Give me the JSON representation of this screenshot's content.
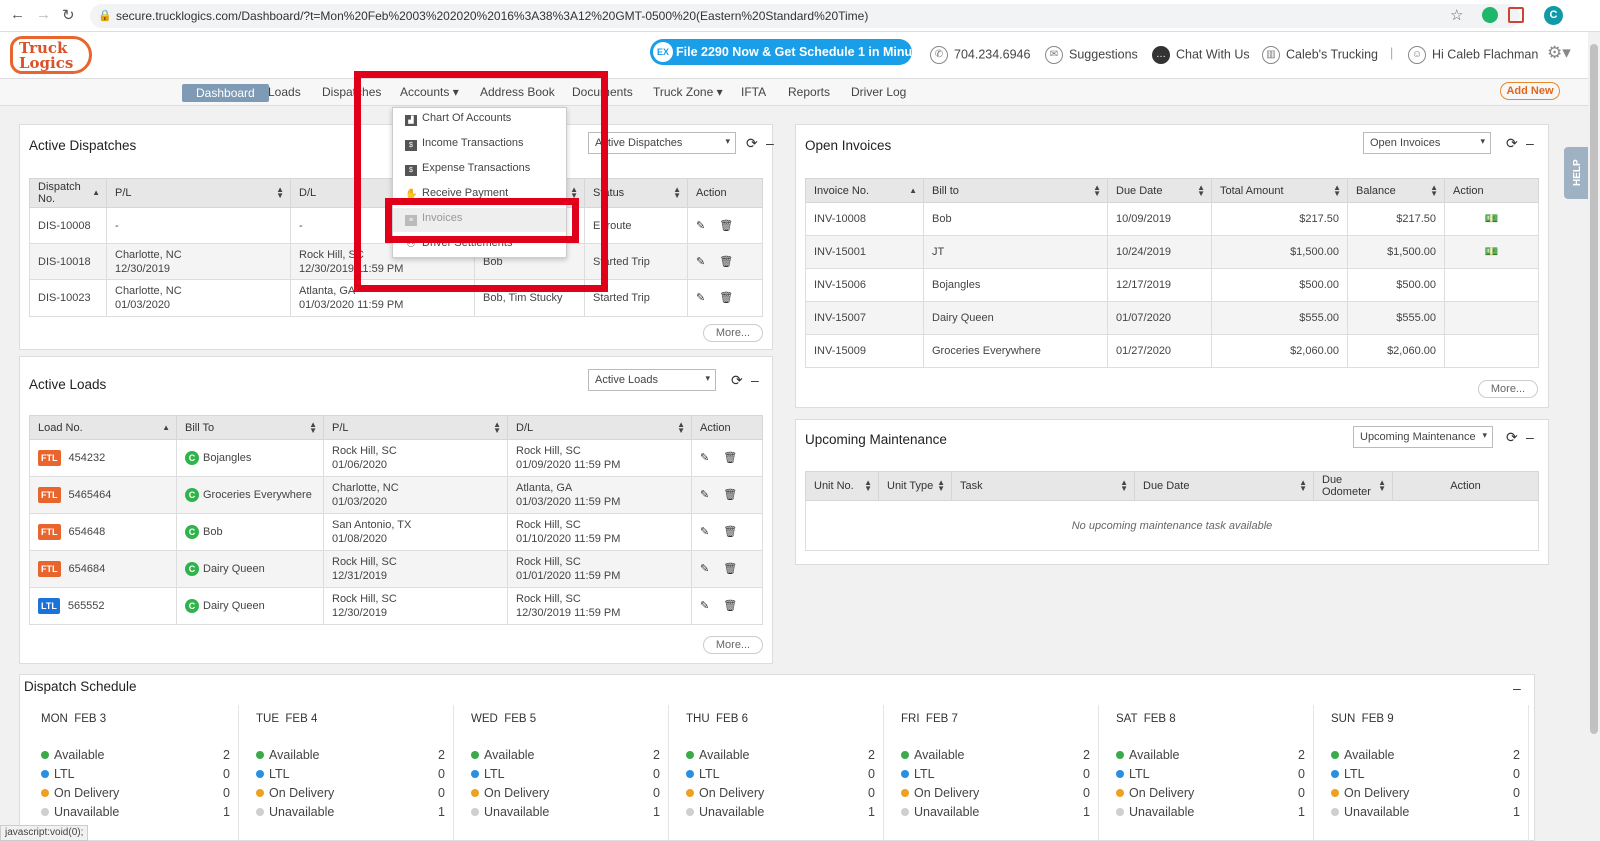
{
  "browser": {
    "url": "secure.trucklogics.com/Dashboard/?t=Mon%20Feb%2003%202020%2016%3A38%3A12%20GMT-0500%20(Eastern%20Standard%20Time)",
    "account_initial": "C",
    "status_text": "javascript:void(0);"
  },
  "header": {
    "logo_line1": "Truck",
    "logo_line2": "Logics",
    "promo": "File 2290 Now & Get Schedule 1 in Minutes",
    "promo_icon": "EX",
    "phone": "704.234.6946",
    "suggestions": "Suggestions",
    "chat": "Chat With Us",
    "company": "Caleb's Trucking",
    "greeting": "Hi Caleb Flachman",
    "icons": [
      "phone-icon",
      "suggestions-icon",
      "chat-icon",
      "company-icon",
      "user-icon",
      "gear-icon"
    ]
  },
  "menu": {
    "items": [
      "Dashboard",
      "Loads",
      "Dispatches",
      "Accounts",
      "Address Book",
      "Documents",
      "Truck Zone",
      "IFTA",
      "Reports",
      "Driver Log"
    ],
    "add_new": "Add New"
  },
  "accounts_menu": [
    "Chart Of Accounts",
    "Income Transactions",
    "Expense Transactions",
    "Receive Payment",
    "Invoices",
    "Driver Settlements"
  ],
  "dispatches": {
    "title": "Active Dispatches",
    "select": "Active Dispatches",
    "headers": [
      "Dispatch No.",
      "P/L",
      "D/L",
      "",
      "Status",
      "Action"
    ],
    "rows": [
      {
        "no": "DIS-10008",
        "pl1": "-",
        "pl2": "",
        "dl1": "-",
        "dl2": "",
        "driver": "",
        "status": "Enroute"
      },
      {
        "no": "DIS-10018",
        "pl1": "Charlotte, NC",
        "pl2": "12/30/2019",
        "dl1": "Rock Hill, SC",
        "dl2": "12/30/2019 11:59 PM",
        "driver": "Bob",
        "status": "Started Trip"
      },
      {
        "no": "DIS-10023",
        "pl1": "Charlotte, NC",
        "pl2": "01/03/2020",
        "dl1": "Atlanta, GA",
        "dl2": "01/03/2020 11:59 PM",
        "driver": "Bob, Tim Stucky",
        "status": "Started Trip"
      }
    ],
    "more": "More..."
  },
  "loads": {
    "title": "Active Loads",
    "select": "Active Loads",
    "headers": [
      "Load No.",
      "Bill To",
      "P/L",
      "D/L",
      "Action"
    ],
    "rows": [
      {
        "type": "FTL",
        "no": "454232",
        "bill": "Bojangles",
        "pl1": "Rock Hill, SC",
        "pl2": "01/06/2020",
        "dl1": "Rock Hill, SC",
        "dl2": "01/09/2020 11:59 PM"
      },
      {
        "type": "FTL",
        "no": "5465464",
        "bill": "Groceries Everywhere",
        "pl1": "Charlotte, NC",
        "pl2": "01/03/2020",
        "dl1": "Atlanta, GA",
        "dl2": "01/03/2020 11:59 PM"
      },
      {
        "type": "FTL",
        "no": "654648",
        "bill": "Bob",
        "pl1": "San Antonio, TX",
        "pl2": "01/08/2020",
        "dl1": "Rock Hill, SC",
        "dl2": "01/10/2020 11:59 PM"
      },
      {
        "type": "FTL",
        "no": "654684",
        "bill": "Dairy Queen",
        "pl1": "Rock Hill, SC",
        "pl2": "12/31/2019",
        "dl1": "Rock Hill, SC",
        "dl2": "01/01/2020 11:59 PM"
      },
      {
        "type": "LTL",
        "no": "565552",
        "bill": "Dairy Queen",
        "pl1": "Rock Hill, SC",
        "pl2": "12/30/2019",
        "dl1": "Rock Hill, SC",
        "dl2": "12/30/2019 11:59 PM"
      }
    ],
    "badge": "C",
    "more": "More..."
  },
  "invoices": {
    "title": "Open Invoices",
    "select": "Open Invoices",
    "headers": [
      "Invoice No.",
      "Bill to",
      "Due Date",
      "Total Amount",
      "Balance",
      "Action"
    ],
    "rows": [
      {
        "no": "INV-10008",
        "bill": "Bob",
        "due": "10/09/2019",
        "total": "$217.50",
        "balance": "$217.50"
      },
      {
        "no": "INV-15001",
        "bill": "JT",
        "due": "10/24/2019",
        "total": "$1,500.00",
        "balance": "$1,500.00"
      },
      {
        "no": "INV-15006",
        "bill": "Bojangles",
        "due": "12/17/2019",
        "total": "$500.00",
        "balance": "$500.00"
      },
      {
        "no": "INV-15007",
        "bill": "Dairy Queen",
        "due": "01/07/2020",
        "total": "$555.00",
        "balance": "$555.00"
      },
      {
        "no": "INV-15009",
        "bill": "Groceries Everywhere",
        "due": "01/27/2020",
        "total": "$2,060.00",
        "balance": "$2,060.00"
      }
    ],
    "more": "More..."
  },
  "maintenance": {
    "title": "Upcoming Maintenance",
    "select": "Upcoming Maintenance",
    "headers": [
      "Unit No.",
      "Unit Type",
      "Task",
      "Due Date",
      "Due Odometer",
      "Action"
    ],
    "empty": "No upcoming maintenance task available"
  },
  "schedule": {
    "title": "Dispatch Schedule",
    "labels": [
      "Available",
      "LTL",
      "On Delivery",
      "Unavailable"
    ],
    "colors": [
      "#3aaa4a",
      "#2b8fe0",
      "#f0a020",
      "#cfcfcf"
    ],
    "days": [
      {
        "dow": "MON",
        "date": "FEB 3",
        "counts": [
          "2",
          "0",
          "0",
          "1"
        ]
      },
      {
        "dow": "TUE",
        "date": "FEB 4",
        "counts": [
          "2",
          "0",
          "0",
          "1"
        ]
      },
      {
        "dow": "WED",
        "date": "FEB 5",
        "counts": [
          "2",
          "0",
          "0",
          "1"
        ]
      },
      {
        "dow": "THU",
        "date": "FEB 6",
        "counts": [
          "2",
          "0",
          "0",
          "1"
        ]
      },
      {
        "dow": "FRI",
        "date": "FEB 7",
        "counts": [
          "2",
          "0",
          "0",
          "1"
        ]
      },
      {
        "dow": "SAT",
        "date": "FEB 8",
        "counts": [
          "2",
          "0",
          "0",
          "1"
        ]
      },
      {
        "dow": "SUN",
        "date": "FEB 9",
        "counts": [
          "2",
          "0",
          "0",
          "1"
        ]
      }
    ]
  },
  "help": "HELP"
}
